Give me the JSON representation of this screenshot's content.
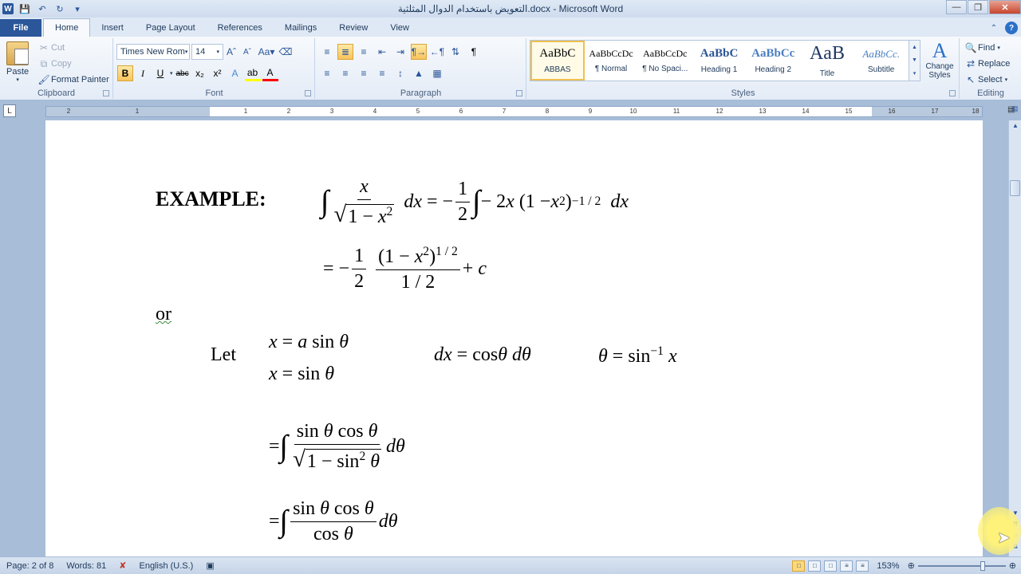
{
  "window": {
    "title": "التعويض باستخدام الدوال المثلثية.docx - Microsoft Word"
  },
  "tabs": [
    "File",
    "Home",
    "Insert",
    "Page Layout",
    "References",
    "Mailings",
    "Review",
    "View"
  ],
  "ribbon": {
    "clipboard": {
      "label": "Clipboard",
      "paste": "Paste",
      "cut": "Cut",
      "copy": "Copy",
      "format_painter": "Format Painter"
    },
    "font": {
      "label": "Font",
      "font_name": "Times New Rom",
      "font_size": "14",
      "change_case": "Aa"
    },
    "paragraph": {
      "label": "Paragraph"
    },
    "styles": {
      "label": "Styles",
      "items": [
        {
          "sample": "AaBbC",
          "name": "ABBAS"
        },
        {
          "sample": "AaBbCcDc",
          "name": "¶ Normal"
        },
        {
          "sample": "AaBbCcDc",
          "name": "¶ No Spaci..."
        },
        {
          "sample": "AaBbC",
          "name": "Heading 1"
        },
        {
          "sample": "AaBbCc",
          "name": "Heading 2"
        },
        {
          "sample": "AaB",
          "name": "Title"
        },
        {
          "sample": "AaBbCc.",
          "name": "Subtitle"
        }
      ],
      "change_styles": "Change Styles"
    },
    "editing": {
      "label": "Editing",
      "find": "Find",
      "replace": "Replace",
      "select": "Select"
    }
  },
  "ruler": {
    "ticks": [
      "2",
      "1",
      "1",
      "2",
      "3",
      "4",
      "5",
      "6",
      "7",
      "8",
      "9",
      "10",
      "11",
      "12",
      "13",
      "14",
      "15",
      "16",
      "17",
      "18",
      "19"
    ]
  },
  "document": {
    "example_label": "EXAMPLE:",
    "or_label": "or",
    "let_label": "Let"
  },
  "status": {
    "page": "Page: 2 of 8",
    "words": "Words: 81",
    "language": "English (U.S.)",
    "zoom": "153%"
  }
}
